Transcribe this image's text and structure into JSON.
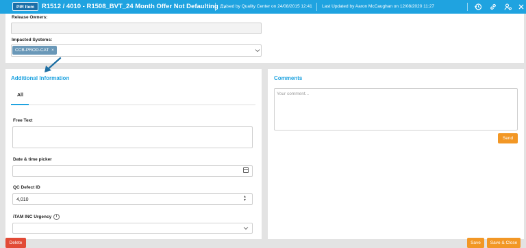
{
  "header": {
    "badge": "PIR Item",
    "title": "R1512 / 4010 - R1508_BVT_24 Month Offer Not Defaulting ...",
    "raised_by": "Raised by Quality Center on 24/08/2015 12:41",
    "last_updated": "Last Updated by Aaron McCaughan on 12/08/2020 11:27",
    "icons": [
      "history-icon",
      "link-icon",
      "users-settings-icon",
      "close-icon"
    ]
  },
  "top": {
    "release_owners_label": "Release Owners:",
    "impacted_systems_label": "Impacted Systems:",
    "impacted_chip": "CCB-PROD-CAT"
  },
  "additional": {
    "title": "Additional Information",
    "tab_all": "All",
    "free_text_label": "Free Text",
    "date_time_label": "Date & time picker",
    "qc_defect_label": "QC Defect ID",
    "qc_defect_value": "4,010",
    "itam_label": "iTAM INC Urgency"
  },
  "comments": {
    "title": "Comments",
    "placeholder": "Your comment...",
    "send_label": "Send"
  },
  "footer": {
    "delete_label": "Delete",
    "save_label": "Save",
    "save_close_label": "Save & Close"
  },
  "colors": {
    "accent": "#1fa3e0",
    "orange": "#f29725",
    "red": "#e24a36",
    "chip": "#6a98b8"
  }
}
